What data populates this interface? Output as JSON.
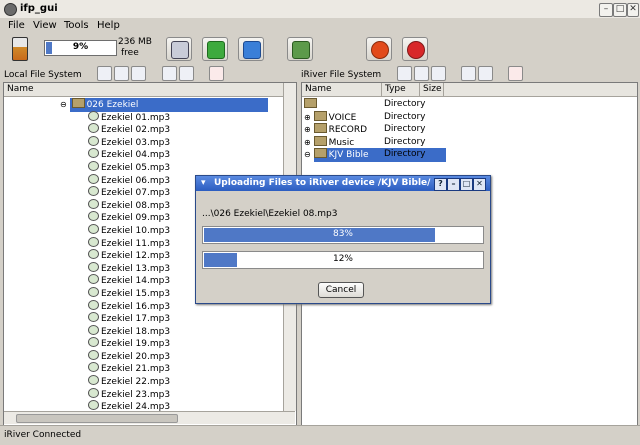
{
  "window": {
    "title": "ifp_gui"
  },
  "menu": [
    "File",
    "View",
    "Tools",
    "Help"
  ],
  "toolbar": {
    "space_percent": "9%",
    "space_fraction": 0.09,
    "space_free_line1": "236 MB",
    "space_free_line2": "free"
  },
  "local": {
    "header": "Local File System",
    "column_name": "Name",
    "folder": "026 Ezekiel",
    "files": [
      "Ezekiel 01.mp3",
      "Ezekiel 02.mp3",
      "Ezekiel 03.mp3",
      "Ezekiel 04.mp3",
      "Ezekiel 05.mp3",
      "Ezekiel 06.mp3",
      "Ezekiel 07.mp3",
      "Ezekiel 08.mp3",
      "Ezekiel 09.mp3",
      "Ezekiel 10.mp3",
      "Ezekiel 11.mp3",
      "Ezekiel 12.mp3",
      "Ezekiel 13.mp3",
      "Ezekiel 14.mp3",
      "Ezekiel 15.mp3",
      "Ezekiel 16.mp3",
      "Ezekiel 17.mp3",
      "Ezekiel 18.mp3",
      "Ezekiel 19.mp3",
      "Ezekiel 20.mp3",
      "Ezekiel 21.mp3",
      "Ezekiel 22.mp3",
      "Ezekiel 23.mp3",
      "Ezekiel 24.mp3"
    ]
  },
  "remote": {
    "header": "iRiver File System",
    "columns": [
      "Name",
      "Type",
      "Size"
    ],
    "root_type": "Directory",
    "rows": [
      {
        "name": "VOICE",
        "type": "Directory"
      },
      {
        "name": "RECORD",
        "type": "Directory"
      },
      {
        "name": "Music",
        "type": "Directory"
      },
      {
        "name": "KJV Bible",
        "type": "Directory"
      }
    ]
  },
  "dialog": {
    "title": "Uploading Files to iRiver device  /KJV Bible/",
    "path": "...\\026 Ezekiel\\Ezekiel 08.mp3",
    "overall_percent": "83%",
    "overall_fraction": 0.83,
    "file_percent": "12%",
    "file_fraction": 0.12,
    "cancel_label": "Cancel"
  },
  "status": "iRiver Connected"
}
